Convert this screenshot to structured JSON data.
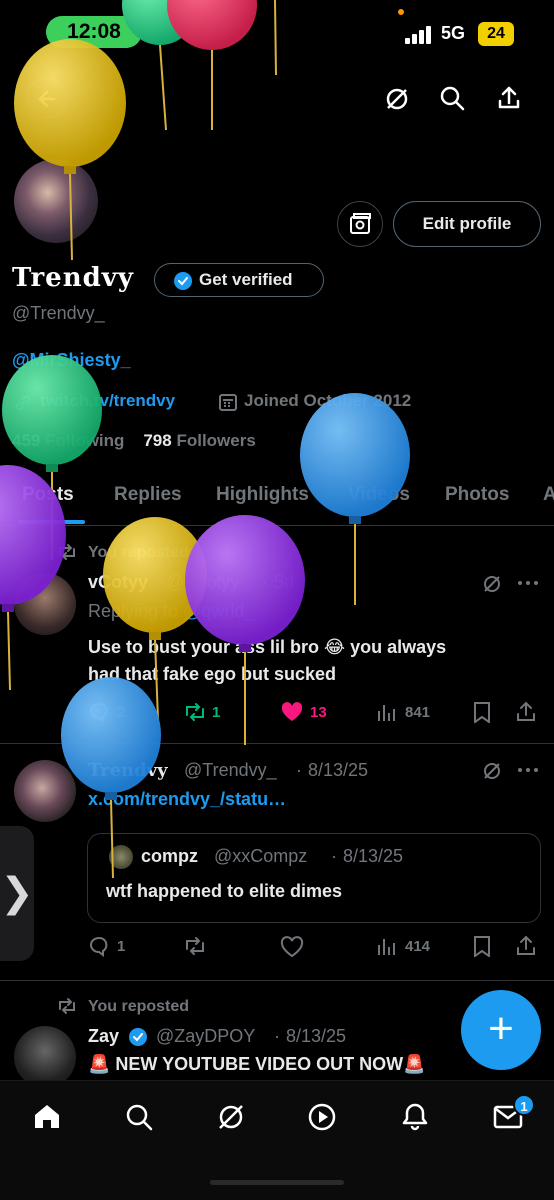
{
  "status_bar": {
    "time": "12:08",
    "network": "5G",
    "battery": "24"
  },
  "profile": {
    "display_name": "Trendvy",
    "get_verified_label": "Get verified",
    "handle": "@Trendvy_",
    "bio_mention": "@MirShiesty_",
    "website": "twitch.tv/trendvy",
    "joined": "Joined October 2012",
    "following_count": "459",
    "following_label": "Following",
    "followers_count": "798",
    "followers_label": "Followers",
    "edit_profile_label": "Edit profile"
  },
  "tabs": [
    "Posts",
    "Replies",
    "Highlights",
    "Videos",
    "Photos",
    "A"
  ],
  "posts": [
    {
      "repost_label": "You reposted",
      "author": "vCotyy",
      "handle": "@vCotyy",
      "time": "5d",
      "reply_prefix": "Replying to",
      "reply_to": "@qwrld_",
      "text_line1": "Use to bust your ass lil bro 😂 you always",
      "text_line2": "had that fake ego but sucked",
      "replies": "2",
      "reposts": "1",
      "likes": "13",
      "views": "841"
    },
    {
      "author": "Trendvy",
      "handle": "@Trendvy_",
      "time": "8/13/25",
      "link": "x.com/trendvy_/statu…",
      "quote": {
        "author": "compz",
        "handle": "@xxCompz",
        "time": "8/13/25",
        "text": "wtf happened to elite dimes"
      },
      "replies": "1",
      "reposts": "",
      "likes": "",
      "views": "414"
    },
    {
      "repost_label": "You reposted",
      "author": "Zay",
      "handle": "@ZayDPOY",
      "time": "8/13/25",
      "text": "🚨 NEW YOUTUBE VIDEO OUT NOW🚨"
    }
  ],
  "nav": {
    "messages_badge": "1"
  },
  "fab_label": "+",
  "side_handle_label": "❯",
  "colors": {
    "accent": "#1d9bf0",
    "like": "#f91880",
    "repost": "#00ba7c",
    "background": "#000000"
  },
  "icons": [
    "back-arrow-icon",
    "grok-icon",
    "search-icon",
    "share-icon",
    "analytics-icon",
    "verified-icon",
    "link-icon",
    "calendar-icon",
    "repost-icon",
    "reply-icon",
    "heart-icon",
    "bookmark-icon",
    "more-icon",
    "home-icon",
    "mail-icon",
    "bell-icon",
    "play-icon"
  ]
}
